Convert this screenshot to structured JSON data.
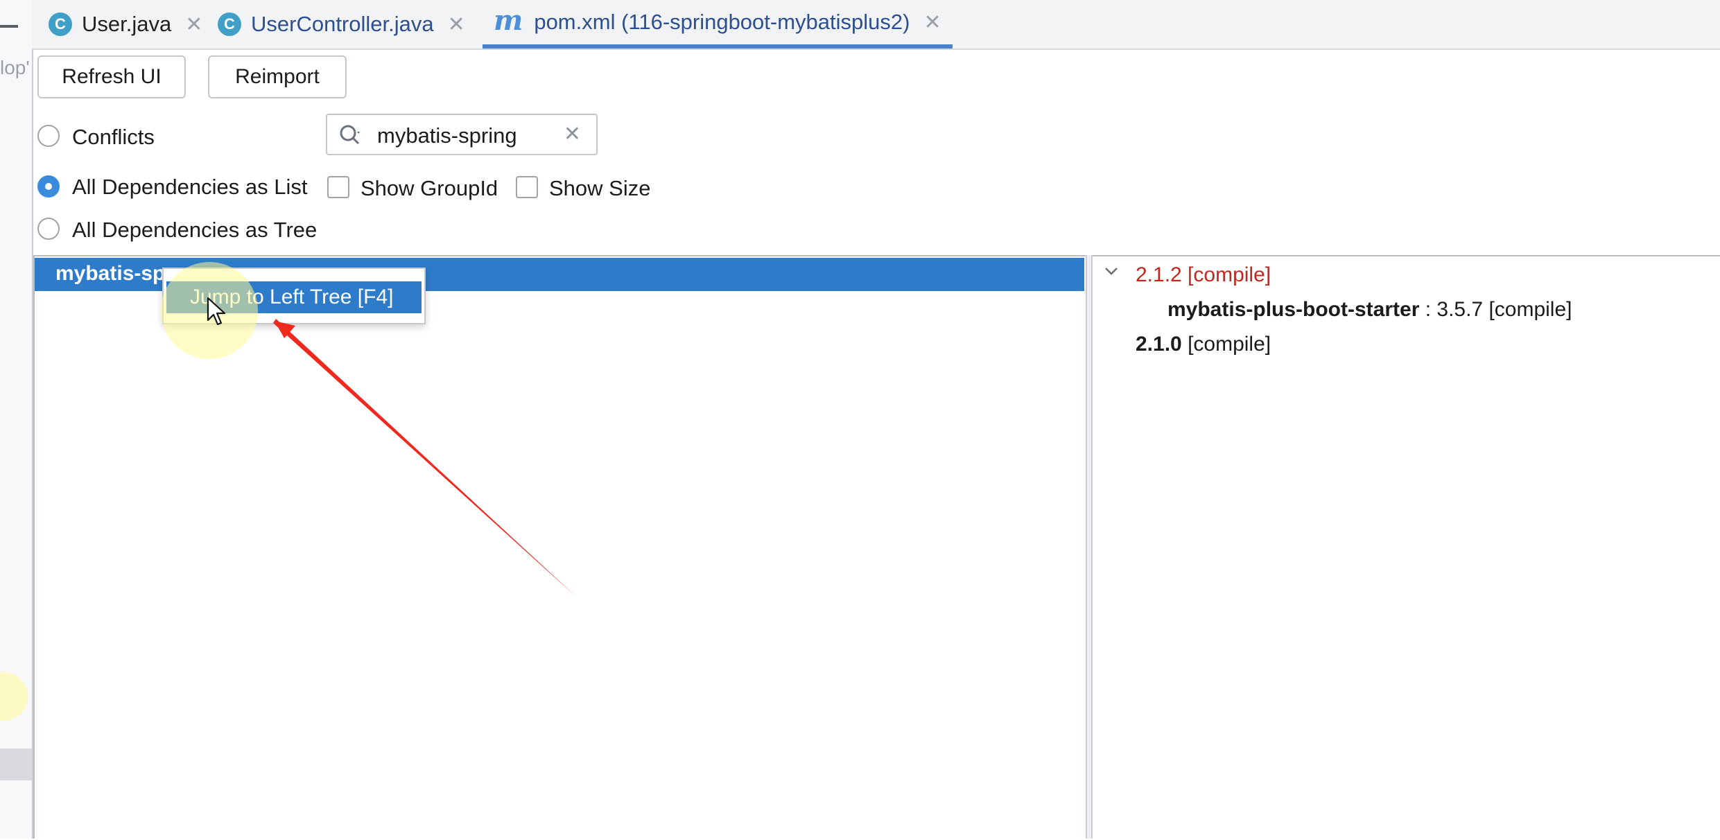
{
  "tabs": [
    {
      "icon": "C",
      "label": "User.java"
    },
    {
      "icon": "C",
      "label": "UserController.java"
    },
    {
      "icon": "m",
      "label": "pom.xml (116-springboot-mybatisplus2)"
    }
  ],
  "gutter": {
    "cut_text": "lop'"
  },
  "toolbar": {
    "refresh_label": "Refresh UI",
    "reimport_label": "Reimport"
  },
  "options": {
    "conflicts": "Conflicts",
    "all_list": "All Dependencies as List",
    "all_tree": "All Dependencies as Tree",
    "show_groupid": "Show GroupId",
    "show_size": "Show Size",
    "selected_mode": "All Dependencies as List"
  },
  "search": {
    "value": "mybatis-spring"
  },
  "left_list": {
    "selected_item": "mybatis-sp"
  },
  "context_menu": {
    "item": "Jump to Left Tree [F4]"
  },
  "right_tree": {
    "version_conflict": "2.1.2 [compile]",
    "parent_name": "mybatis-plus-boot-starter",
    "parent_rest": " : 3.5.7 [compile]",
    "version_resolved": "2.1.0",
    "version_resolved_scope": " [compile]"
  },
  "colors": {
    "accent": "#2e7bc9",
    "conflict_red": "#c0271f",
    "annotation_arrow": "#f0281e"
  }
}
